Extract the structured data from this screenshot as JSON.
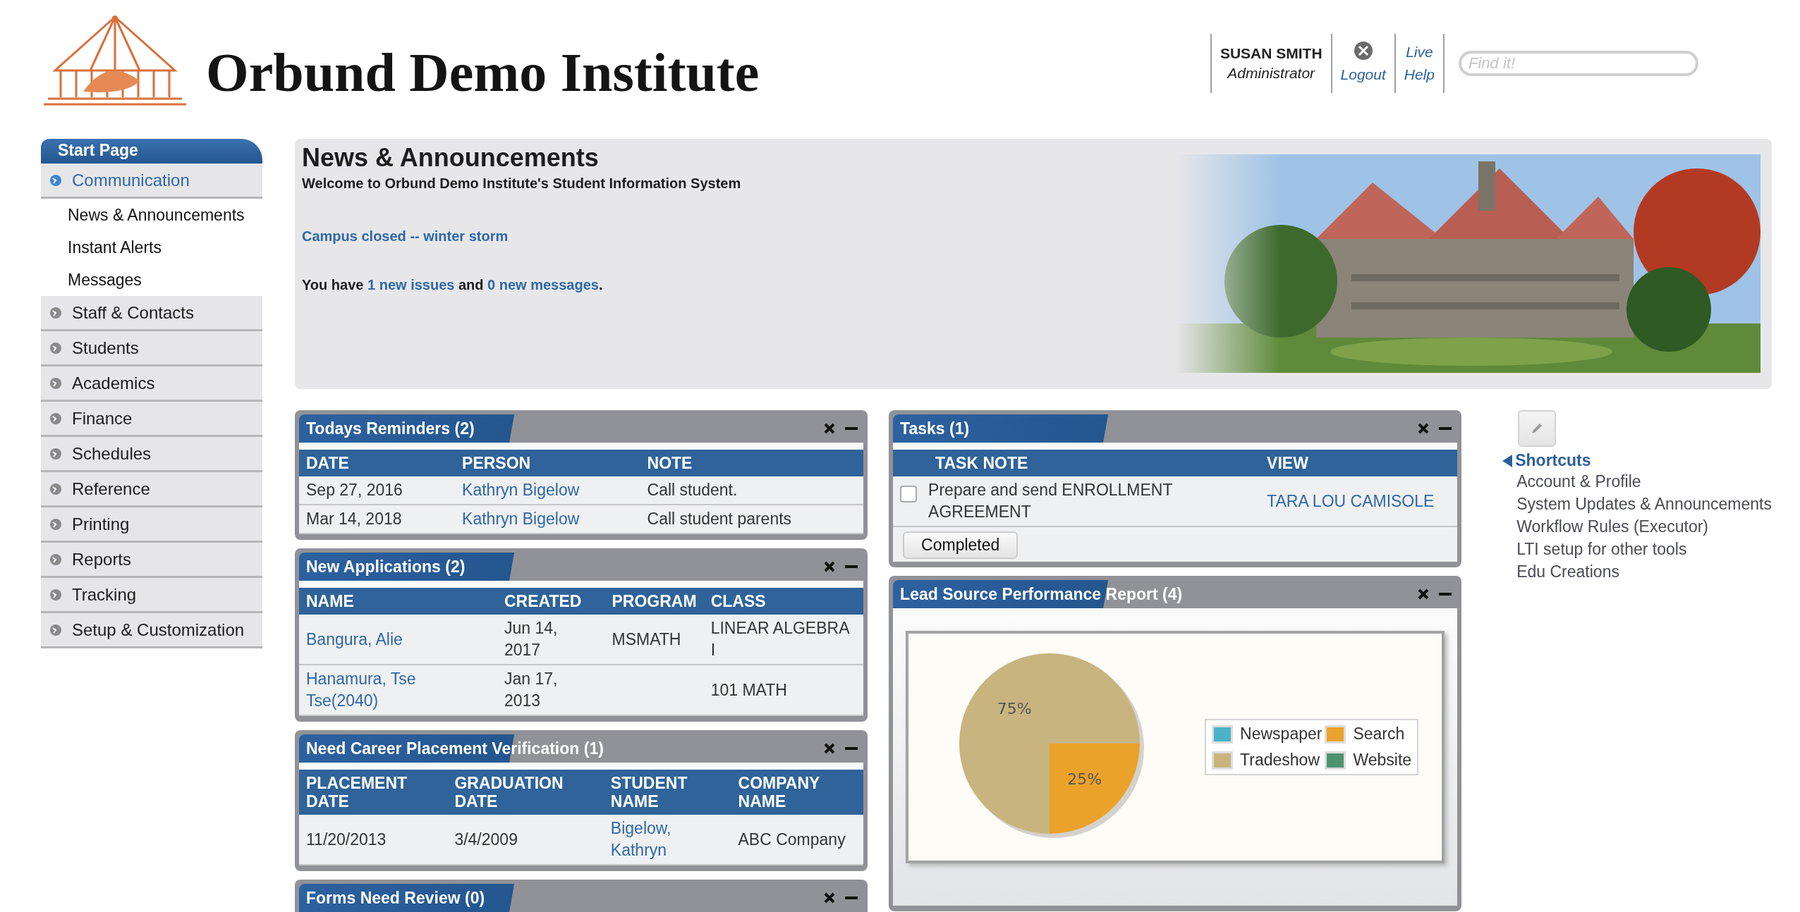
{
  "header": {
    "title": "Orbund Demo Institute",
    "user": {
      "name": "SUSAN SMITH",
      "role": "Administrator"
    },
    "logout": "Logout",
    "help": "Live Help",
    "search": {
      "placeholder": "Find it!"
    }
  },
  "sidebar": {
    "header": "Start Page",
    "items": [
      {
        "label": "Communication",
        "expanded": true,
        "children": [
          {
            "label": "News & Announcements"
          },
          {
            "label": "Instant Alerts"
          },
          {
            "label": "Messages"
          }
        ]
      },
      {
        "label": "Staff & Contacts",
        "expanded": false
      },
      {
        "label": "Students",
        "expanded": false
      },
      {
        "label": "Academics",
        "expanded": false
      },
      {
        "label": "Finance",
        "expanded": false
      },
      {
        "label": "Schedules",
        "expanded": false
      },
      {
        "label": "Reference",
        "expanded": false
      },
      {
        "label": "Printing",
        "expanded": false
      },
      {
        "label": "Reports",
        "expanded": false
      },
      {
        "label": "Tracking",
        "expanded": false
      },
      {
        "label": "Setup & Customization",
        "expanded": false
      }
    ]
  },
  "news": {
    "title": "News & Announcements",
    "subtitle": "Welcome to Orbund Demo Institute's Student Information System",
    "headline": "Campus closed -- winter storm",
    "message": {
      "before": "You have ",
      "issues": "1 new issues",
      "middle": " and ",
      "messages": "0 new messages",
      "after": "."
    }
  },
  "left_widgets": [
    {
      "kind": "table",
      "title": "Todays Reminders (2)",
      "columns": [
        {
          "label": "DATE",
          "kind": "text"
        },
        {
          "label": "PERSON",
          "kind": "link"
        },
        {
          "label": "NOTE",
          "kind": "text"
        }
      ],
      "rows": [
        [
          "Sep 27, 2016",
          "Kathryn Bigelow",
          "Call student."
        ],
        [
          "Mar 14, 2018",
          "Kathryn Bigelow",
          "Call student parents"
        ]
      ]
    },
    {
      "kind": "table",
      "title": "New Applications (2)",
      "columns": [
        {
          "label": "NAME",
          "kind": "link"
        },
        {
          "label": "CREATED",
          "kind": "text"
        },
        {
          "label": "PROGRAM",
          "kind": "text"
        },
        {
          "label": "CLASS",
          "kind": "text"
        }
      ],
      "rows": [
        [
          "Bangura, Alie",
          "Jun 14, 2017",
          "MSMATH",
          "LINEAR ALGEBRA I"
        ],
        [
          "Hanamura, Tse Tse(2040)",
          "Jan 17, 2013",
          null,
          "101 MATH"
        ]
      ]
    },
    {
      "kind": "table",
      "title": "Need Career Placement Verification (1)",
      "columns": [
        {
          "label": "PLACEMENT DATE",
          "kind": "text"
        },
        {
          "label": "GRADUATION DATE",
          "kind": "text"
        },
        {
          "label": "STUDENT NAME",
          "kind": "link"
        },
        {
          "label": "COMPANY NAME",
          "kind": "text"
        }
      ],
      "rows": [
        [
          "11/20/2013",
          "3/4/2009",
          "Bigelow, Kathryn",
          "ABC Company"
        ]
      ]
    },
    {
      "kind": "stub",
      "title": "Forms Need Review (0)"
    }
  ],
  "right_widgets": [
    {
      "kind": "tasks",
      "title": "Tasks (1)",
      "columns": [
        "TASK NOTE",
        "VIEW"
      ],
      "rows": [
        {
          "note": "Prepare and send ENROLLMENT AGREEMENT",
          "view": "TARA LOU CAMISOLE",
          "checked": false
        }
      ],
      "button": "Completed"
    },
    {
      "kind": "chart",
      "title": "Lead Source Performance Report (4)",
      "chart_data": {
        "type": "pie",
        "categories": [
          "Newspaper",
          "Search",
          "Tradeshow",
          "Website"
        ],
        "values": [
          0,
          25,
          75,
          0
        ],
        "colors": [
          "#4bb3c8",
          "#eba22a",
          "#c8b47f",
          "#4e9370"
        ],
        "value_labels": [
          null,
          "25%",
          "75%",
          null
        ],
        "legend": "right"
      }
    }
  ],
  "shortcuts": {
    "title": "Shortcuts",
    "items": [
      "Account & Profile",
      "System Updates & Announcements",
      "Workflow Rules (Executor)",
      "LTI setup for other tools",
      "Edu Creations"
    ]
  }
}
